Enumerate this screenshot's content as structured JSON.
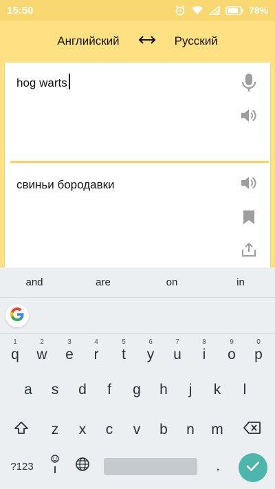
{
  "status_bar": {
    "time": "15:50",
    "battery": "78%"
  },
  "header": {
    "source_lang": "Английский",
    "target_lang": "Русский",
    "swap_icon": "swap-arrows-icon"
  },
  "translator": {
    "input_value": "hog warts",
    "output_text": "свиньи бородавки"
  },
  "suggestions": [
    "and",
    "are",
    "on",
    "in"
  ],
  "keyboard": {
    "row1": [
      {
        "hint": "1",
        "label": "q"
      },
      {
        "hint": "2",
        "label": "w"
      },
      {
        "hint": "3",
        "label": "e"
      },
      {
        "hint": "4",
        "label": "r"
      },
      {
        "hint": "5",
        "label": "t"
      },
      {
        "hint": "6",
        "label": "y"
      },
      {
        "hint": "7",
        "label": "u"
      },
      {
        "hint": "8",
        "label": "i"
      },
      {
        "hint": "9",
        "label": "o"
      },
      {
        "hint": "0",
        "label": "p"
      }
    ],
    "row2": [
      "a",
      "s",
      "d",
      "f",
      "g",
      "h",
      "j",
      "k",
      "l"
    ],
    "row3": [
      "z",
      "x",
      "c",
      "v",
      "b",
      "n",
      "m"
    ],
    "symbols_label": "?123",
    "period_label": "."
  },
  "colors": {
    "accent_yellow": "#FFE082",
    "divider_yellow": "#FFD54F",
    "enter_teal": "#4DB6AC",
    "icon_grey": "#9E9E9E"
  }
}
